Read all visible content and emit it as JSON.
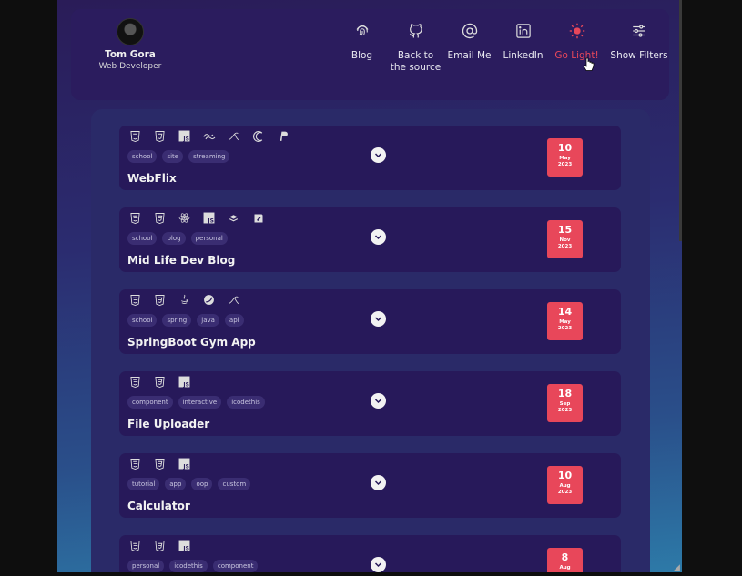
{
  "profile": {
    "name": "Tom Gora",
    "role": "Web Developer"
  },
  "nav": [
    {
      "label": "Blog",
      "icon": "fingerprint-icon"
    },
    {
      "label": "Back to the source",
      "icon": "github-icon"
    },
    {
      "label": "Email Me",
      "icon": "at-sign-icon"
    },
    {
      "label": "LinkedIn",
      "icon": "linkedin-icon"
    },
    {
      "label": "Go Light!",
      "icon": "sun-icon"
    },
    {
      "label": "Show Filters",
      "icon": "sliders-icon"
    }
  ],
  "colors": {
    "accent": "#e8475a",
    "card": "#27195a",
    "header": "#2b1c5e",
    "panel": "#2a2a68"
  },
  "projects": [
    {
      "title": "WebFlix",
      "tags": [
        "school",
        "site",
        "streaming"
      ],
      "day": "10",
      "month": "May",
      "year": "2023",
      "techs": [
        "html5-icon",
        "css3-icon",
        "javascript-icon",
        "tailwind-icon",
        "mysql-icon",
        "mongoose-icon",
        "paypal-icon"
      ]
    },
    {
      "title": "Mid Life Dev Blog",
      "tags": [
        "school",
        "blog",
        "personal"
      ],
      "day": "15",
      "month": "Nov",
      "year": "2023",
      "techs": [
        "html5-icon",
        "css3-icon",
        "react-icon",
        "javascript-icon",
        "cloud-icon",
        "editor-icon"
      ]
    },
    {
      "title": "SpringBoot Gym App",
      "tags": [
        "school",
        "spring",
        "java",
        "api"
      ],
      "day": "14",
      "month": "May",
      "year": "2023",
      "techs": [
        "html5-icon",
        "css3-icon",
        "java-icon",
        "spring-icon",
        "mysql-icon"
      ]
    },
    {
      "title": "File Uploader",
      "tags": [
        "component",
        "interactive",
        "icodethis"
      ],
      "day": "18",
      "month": "Sep",
      "year": "2023",
      "techs": [
        "html5-icon",
        "css3-icon",
        "javascript-icon"
      ]
    },
    {
      "title": "Calculator",
      "tags": [
        "tutorial",
        "app",
        "oop",
        "custom"
      ],
      "day": "10",
      "month": "Aug",
      "year": "2023",
      "techs": [
        "html5-icon",
        "css3-icon",
        "javascript-icon"
      ]
    },
    {
      "title": "",
      "tags": [
        "personal",
        "icodethis",
        "component"
      ],
      "day": "8",
      "month": "Aug",
      "year": "",
      "techs": [
        "html5-icon",
        "css3-icon",
        "javascript-icon"
      ]
    }
  ]
}
